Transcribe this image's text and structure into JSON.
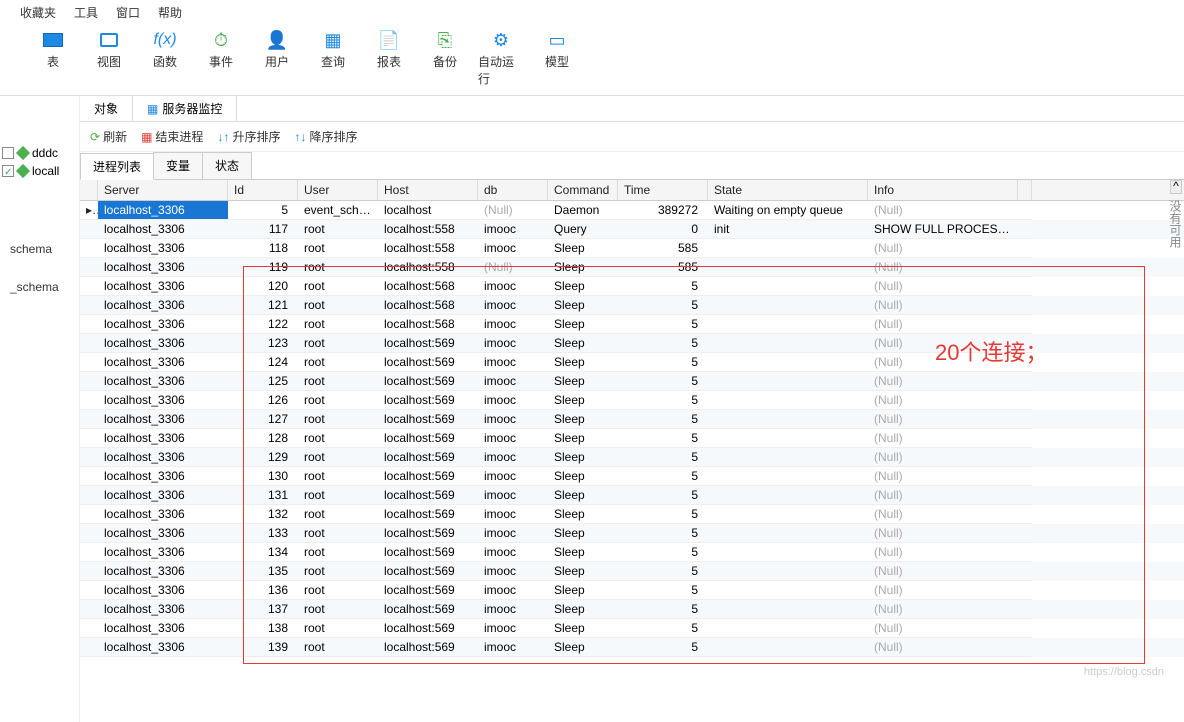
{
  "menu": {
    "favorites": "收藏夹",
    "tools": "工具",
    "window": "窗口",
    "help": "帮助"
  },
  "toolbar": [
    {
      "id": "table",
      "label": "表"
    },
    {
      "id": "view",
      "label": "视图"
    },
    {
      "id": "func",
      "label": "函数"
    },
    {
      "id": "event",
      "label": "事件"
    },
    {
      "id": "user",
      "label": "用户"
    },
    {
      "id": "query",
      "label": "查询"
    },
    {
      "id": "report",
      "label": "报表"
    },
    {
      "id": "backup",
      "label": "备份"
    },
    {
      "id": "autorun",
      "label": "自动运行"
    },
    {
      "id": "model",
      "label": "模型"
    }
  ],
  "sidebar": {
    "items": [
      {
        "name": "dddc",
        "checked": false
      },
      {
        "name": "locall",
        "checked": true
      }
    ],
    "schemas": [
      "schema",
      "_schema"
    ]
  },
  "tabs1": {
    "objects": "对象",
    "monitor": "服务器监控"
  },
  "actions": {
    "refresh": "刷新",
    "kill": "结束进程",
    "asc": "升序排序",
    "desc": "降序排序"
  },
  "tabs2": {
    "proclist": "进程列表",
    "vars": "变量",
    "status": "状态"
  },
  "columns": [
    "",
    "Server",
    "Id",
    "User",
    "Host",
    "db",
    "Command",
    "Time",
    "State",
    "Info",
    ""
  ],
  "rows": [
    {
      "sel": true,
      "server": "localhost_3306",
      "id": 5,
      "user": "event_schedu",
      "host": "localhost",
      "db": "(Null)",
      "cmd": "Daemon",
      "time": 389272,
      "state": "Waiting on empty queue",
      "info": "(Null)"
    },
    {
      "server": "localhost_3306",
      "id": 117,
      "user": "root",
      "host": "localhost:558",
      "db": "imooc",
      "cmd": "Query",
      "time": 0,
      "state": "init",
      "info": "SHOW FULL PROCESSLI"
    },
    {
      "server": "localhost_3306",
      "id": 118,
      "user": "root",
      "host": "localhost:558",
      "db": "imooc",
      "cmd": "Sleep",
      "time": 585,
      "state": "",
      "info": "(Null)"
    },
    {
      "server": "localhost_3306",
      "id": 119,
      "user": "root",
      "host": "localhost:558",
      "db": "(Null)",
      "cmd": "Sleep",
      "time": 585,
      "state": "",
      "info": "(Null)"
    },
    {
      "server": "localhost_3306",
      "id": 120,
      "user": "root",
      "host": "localhost:568",
      "db": "imooc",
      "cmd": "Sleep",
      "time": 5,
      "state": "",
      "info": "(Null)"
    },
    {
      "server": "localhost_3306",
      "id": 121,
      "user": "root",
      "host": "localhost:568",
      "db": "imooc",
      "cmd": "Sleep",
      "time": 5,
      "state": "",
      "info": "(Null)"
    },
    {
      "server": "localhost_3306",
      "id": 122,
      "user": "root",
      "host": "localhost:568",
      "db": "imooc",
      "cmd": "Sleep",
      "time": 5,
      "state": "",
      "info": "(Null)"
    },
    {
      "server": "localhost_3306",
      "id": 123,
      "user": "root",
      "host": "localhost:569",
      "db": "imooc",
      "cmd": "Sleep",
      "time": 5,
      "state": "",
      "info": "(Null)"
    },
    {
      "server": "localhost_3306",
      "id": 124,
      "user": "root",
      "host": "localhost:569",
      "db": "imooc",
      "cmd": "Sleep",
      "time": 5,
      "state": "",
      "info": "(Null)"
    },
    {
      "server": "localhost_3306",
      "id": 125,
      "user": "root",
      "host": "localhost:569",
      "db": "imooc",
      "cmd": "Sleep",
      "time": 5,
      "state": "",
      "info": "(Null)"
    },
    {
      "server": "localhost_3306",
      "id": 126,
      "user": "root",
      "host": "localhost:569",
      "db": "imooc",
      "cmd": "Sleep",
      "time": 5,
      "state": "",
      "info": "(Null)"
    },
    {
      "server": "localhost_3306",
      "id": 127,
      "user": "root",
      "host": "localhost:569",
      "db": "imooc",
      "cmd": "Sleep",
      "time": 5,
      "state": "",
      "info": "(Null)"
    },
    {
      "server": "localhost_3306",
      "id": 128,
      "user": "root",
      "host": "localhost:569",
      "db": "imooc",
      "cmd": "Sleep",
      "time": 5,
      "state": "",
      "info": "(Null)"
    },
    {
      "server": "localhost_3306",
      "id": 129,
      "user": "root",
      "host": "localhost:569",
      "db": "imooc",
      "cmd": "Sleep",
      "time": 5,
      "state": "",
      "info": "(Null)"
    },
    {
      "server": "localhost_3306",
      "id": 130,
      "user": "root",
      "host": "localhost:569",
      "db": "imooc",
      "cmd": "Sleep",
      "time": 5,
      "state": "",
      "info": "(Null)"
    },
    {
      "server": "localhost_3306",
      "id": 131,
      "user": "root",
      "host": "localhost:569",
      "db": "imooc",
      "cmd": "Sleep",
      "time": 5,
      "state": "",
      "info": "(Null)"
    },
    {
      "server": "localhost_3306",
      "id": 132,
      "user": "root",
      "host": "localhost:569",
      "db": "imooc",
      "cmd": "Sleep",
      "time": 5,
      "state": "",
      "info": "(Null)"
    },
    {
      "server": "localhost_3306",
      "id": 133,
      "user": "root",
      "host": "localhost:569",
      "db": "imooc",
      "cmd": "Sleep",
      "time": 5,
      "state": "",
      "info": "(Null)"
    },
    {
      "server": "localhost_3306",
      "id": 134,
      "user": "root",
      "host": "localhost:569",
      "db": "imooc",
      "cmd": "Sleep",
      "time": 5,
      "state": "",
      "info": "(Null)"
    },
    {
      "server": "localhost_3306",
      "id": 135,
      "user": "root",
      "host": "localhost:569",
      "db": "imooc",
      "cmd": "Sleep",
      "time": 5,
      "state": "",
      "info": "(Null)"
    },
    {
      "server": "localhost_3306",
      "id": 136,
      "user": "root",
      "host": "localhost:569",
      "db": "imooc",
      "cmd": "Sleep",
      "time": 5,
      "state": "",
      "info": "(Null)"
    },
    {
      "server": "localhost_3306",
      "id": 137,
      "user": "root",
      "host": "localhost:569",
      "db": "imooc",
      "cmd": "Sleep",
      "time": 5,
      "state": "",
      "info": "(Null)"
    },
    {
      "server": "localhost_3306",
      "id": 138,
      "user": "root",
      "host": "localhost:569",
      "db": "imooc",
      "cmd": "Sleep",
      "time": 5,
      "state": "",
      "info": "(Null)"
    },
    {
      "server": "localhost_3306",
      "id": 139,
      "user": "root",
      "host": "localhost:569",
      "db": "imooc",
      "cmd": "Sleep",
      "time": 5,
      "state": "",
      "info": "(Null)"
    }
  ],
  "annotation": "20个连接；",
  "rside": "没有可用",
  "watermark": "https://blog.csdn"
}
